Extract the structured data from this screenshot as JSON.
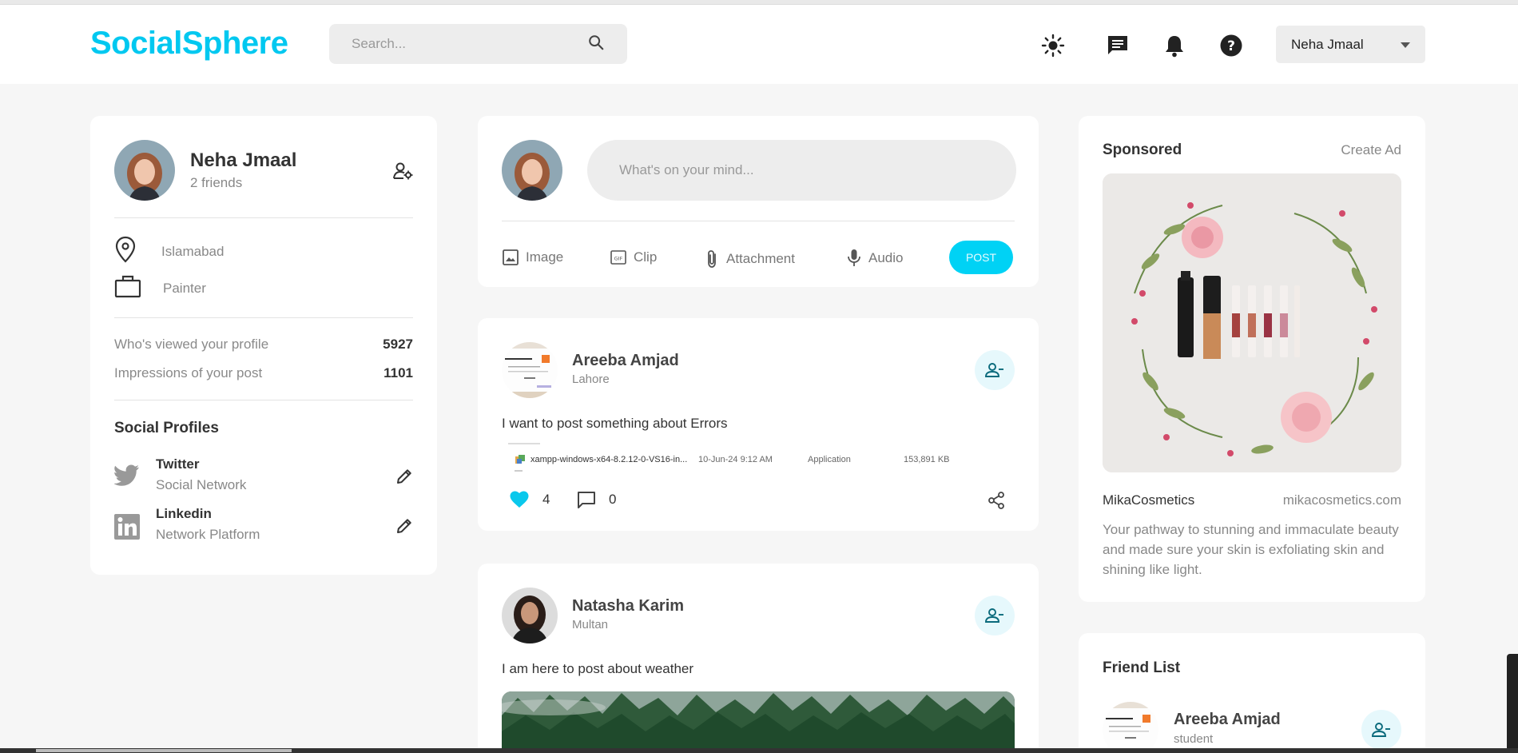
{
  "header": {
    "logo": "SocialSphere",
    "search_placeholder": "Search...",
    "user_name": "Neha Jmaal"
  },
  "profile": {
    "name": "Neha Jmaal",
    "friends": "2 friends",
    "location": "Islamabad",
    "occupation": "Painter",
    "stats": [
      {
        "label": "Who's viewed your profile",
        "value": "5927"
      },
      {
        "label": "Impressions of your post",
        "value": "1101"
      }
    ],
    "social_title": "Social Profiles",
    "socials": [
      {
        "name": "Twitter",
        "sub": "Social Network"
      },
      {
        "name": "Linkedin",
        "sub": "Network Platform"
      }
    ]
  },
  "composer": {
    "placeholder": "What's on your mind...",
    "tools": [
      "Image",
      "Clip",
      "Attachment",
      "Audio"
    ],
    "post_label": "POST"
  },
  "posts": [
    {
      "author": "Areeba Amjad",
      "location": "Lahore",
      "text": "I want to post something about Errors",
      "attachment": {
        "file": "xampp-windows-x64-8.2.12-0-VS16-in...",
        "date": "10-Jun-24 9:12 AM",
        "type": "Application",
        "size": "153,891 KB"
      },
      "likes": "4",
      "comments": "0"
    },
    {
      "author": "Natasha Karim",
      "location": "Multan",
      "text": "I am here to post about weather"
    }
  ],
  "sponsored": {
    "title": "Sponsored",
    "create": "Create Ad",
    "brand": "MikaCosmetics",
    "url": "mikacosmetics.com",
    "desc": "Your pathway to stunning and immaculate beauty and made sure your skin is exfoliating skin and shining like light."
  },
  "friend_list": {
    "title": "Friend List",
    "items": [
      {
        "name": "Areeba Amjad",
        "sub": "student"
      }
    ]
  },
  "colors": {
    "accent": "#00c8f0",
    "background": "#f6f6f6",
    "card": "#ffffff",
    "follow_button_bg": "#e6f8fc",
    "follow_icon": "#0a6a7c"
  }
}
